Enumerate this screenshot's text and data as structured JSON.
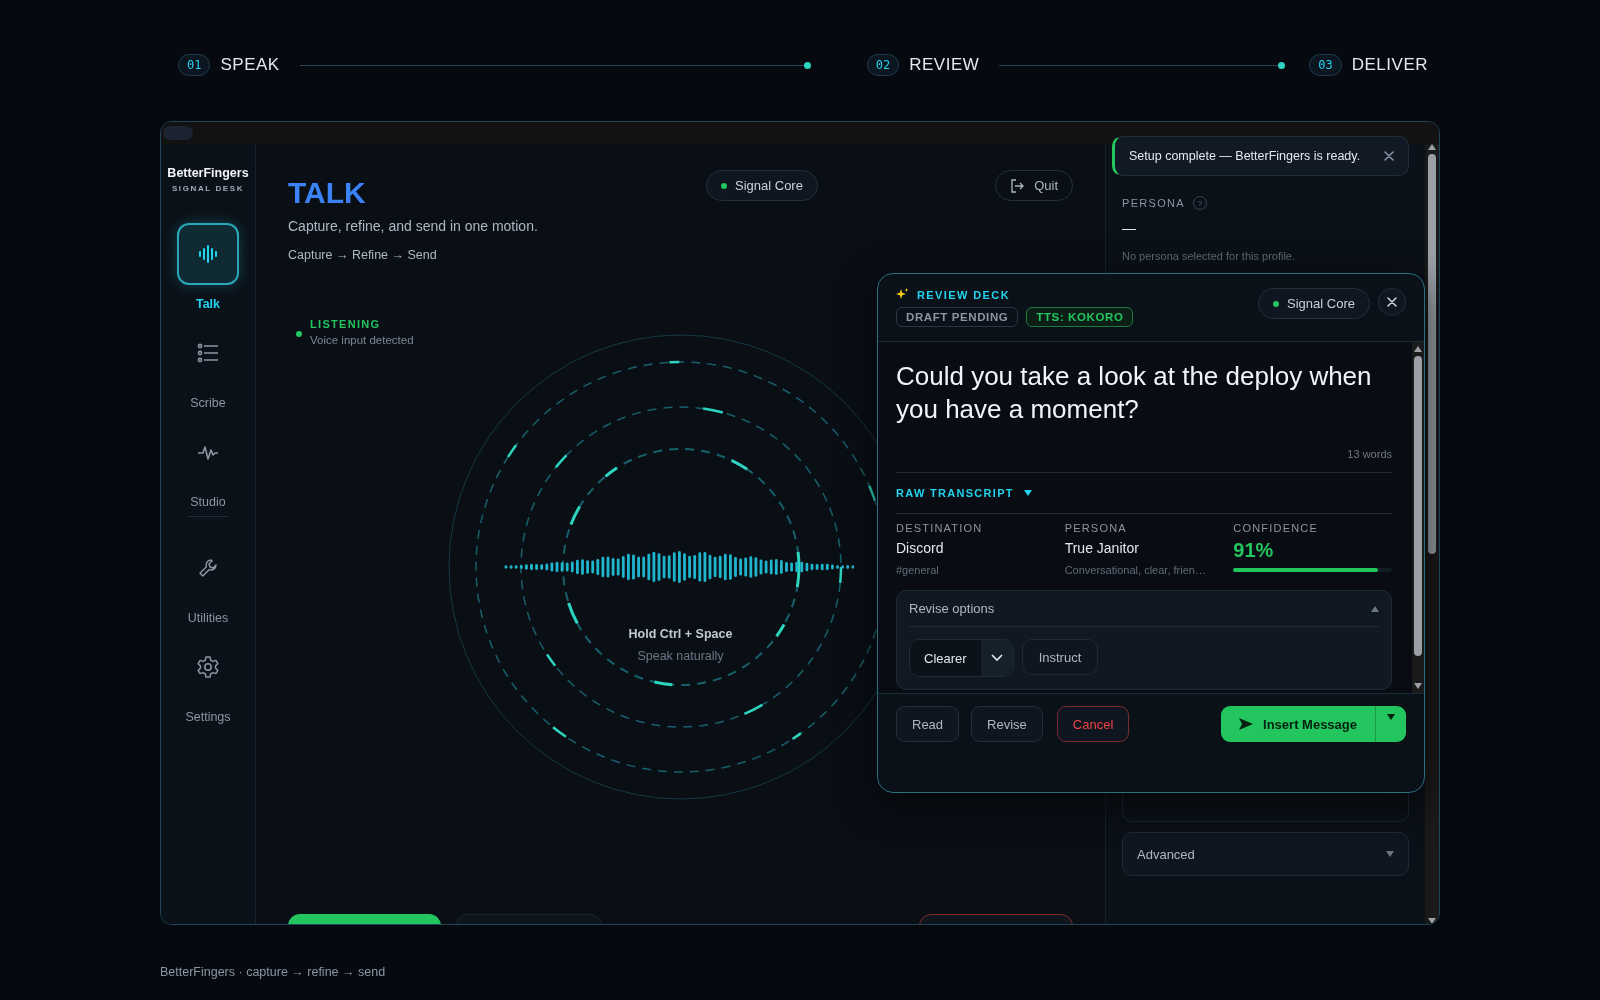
{
  "stepper": [
    {
      "number": "01",
      "label": "SPEAK"
    },
    {
      "number": "02",
      "label": "REVIEW"
    },
    {
      "number": "03",
      "label": "DELIVER"
    }
  ],
  "sidebar": {
    "brand": "BetterFingers",
    "subtitle": "SIGNAL DESK",
    "items": [
      {
        "label": "Talk",
        "selected": true
      },
      {
        "label": "Scribe",
        "selected": false
      },
      {
        "label": "Studio",
        "selected": false
      },
      {
        "label": "Utilities",
        "selected": false
      },
      {
        "label": "Settings",
        "selected": false
      }
    ]
  },
  "main": {
    "title": "TALK",
    "subtitle": "Capture, refine, and send in one motion.",
    "flow": "Capture → Refine → Send",
    "status_pill": "Signal Core",
    "quit": "Quit",
    "listening": {
      "label": "LISTENING",
      "detail": "Voice input detected"
    },
    "prompt": {
      "title": "Hold Ctrl + Space",
      "hint": "Speak naturally"
    }
  },
  "right_panel": {
    "toast": {
      "message": "Setup complete — BetterFingers is ready."
    },
    "persona": {
      "label": "PERSONA",
      "help": "?",
      "value": "—",
      "note": "No persona selected for this profile."
    },
    "advanced": {
      "label": "Advanced",
      "expanded": false
    }
  },
  "review_deck": {
    "title": "REVIEW DECK",
    "badges": [
      {
        "label": "DRAFT PENDING",
        "kind": "neutral"
      },
      {
        "label": "TTS: KOKORO",
        "kind": "success"
      }
    ],
    "status_pill": "Signal Core",
    "message": "Could you take a look at the deploy when you have a moment?",
    "word_count": "13 words",
    "raw_transcript": {
      "label": "RAW TRANSCRIPT",
      "expanded": false
    },
    "destination": {
      "label": "DESTINATION",
      "value": "Discord",
      "detail": "#general"
    },
    "persona": {
      "label": "PERSONA",
      "value": "True Janitor",
      "detail": "Conversational, clear, frien…"
    },
    "confidence": {
      "label": "CONFIDENCE",
      "value": "91%",
      "level": 0.91
    },
    "revise_options": {
      "label": "Revise options",
      "expanded": true,
      "style": "Clearer",
      "instruct": "Instruct"
    },
    "buttons": [
      {
        "label": "Read",
        "kind": "secondary"
      },
      {
        "label": "Revise",
        "kind": "secondary"
      },
      {
        "label": "Cancel",
        "kind": "danger"
      }
    ],
    "primary": "Insert Message"
  },
  "footer": "BetterFingers · capture → refine → send"
}
